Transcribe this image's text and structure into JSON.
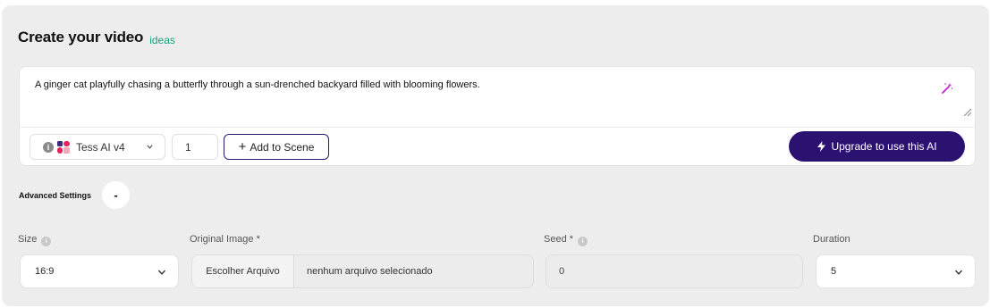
{
  "header": {
    "title": "Create your video",
    "ideas_link": "ideas"
  },
  "prompt": {
    "text": "A ginger cat playfully chasing a butterfly through a sun-drenched backyard filled with blooming flowers.",
    "model": {
      "label": "Tess AI v4",
      "info": "i"
    },
    "count": "1",
    "add_scene_label": "Add to Scene",
    "upgrade_label": "Upgrade to use this AI"
  },
  "advanced": {
    "label": "Advanced Settings",
    "toggle": "-"
  },
  "fields": {
    "size": {
      "label": "Size",
      "value": "16:9"
    },
    "original_image": {
      "label": "Original Image *",
      "button": "Escolher Arquivo",
      "status": "nenhum arquivo selecionado"
    },
    "seed": {
      "label": "Seed *",
      "value": "0"
    },
    "duration": {
      "label": "Duration",
      "value": "5"
    }
  },
  "colors": {
    "accent": "#2b1170",
    "ideas": "#10a37f",
    "wand": "#c026d3"
  }
}
